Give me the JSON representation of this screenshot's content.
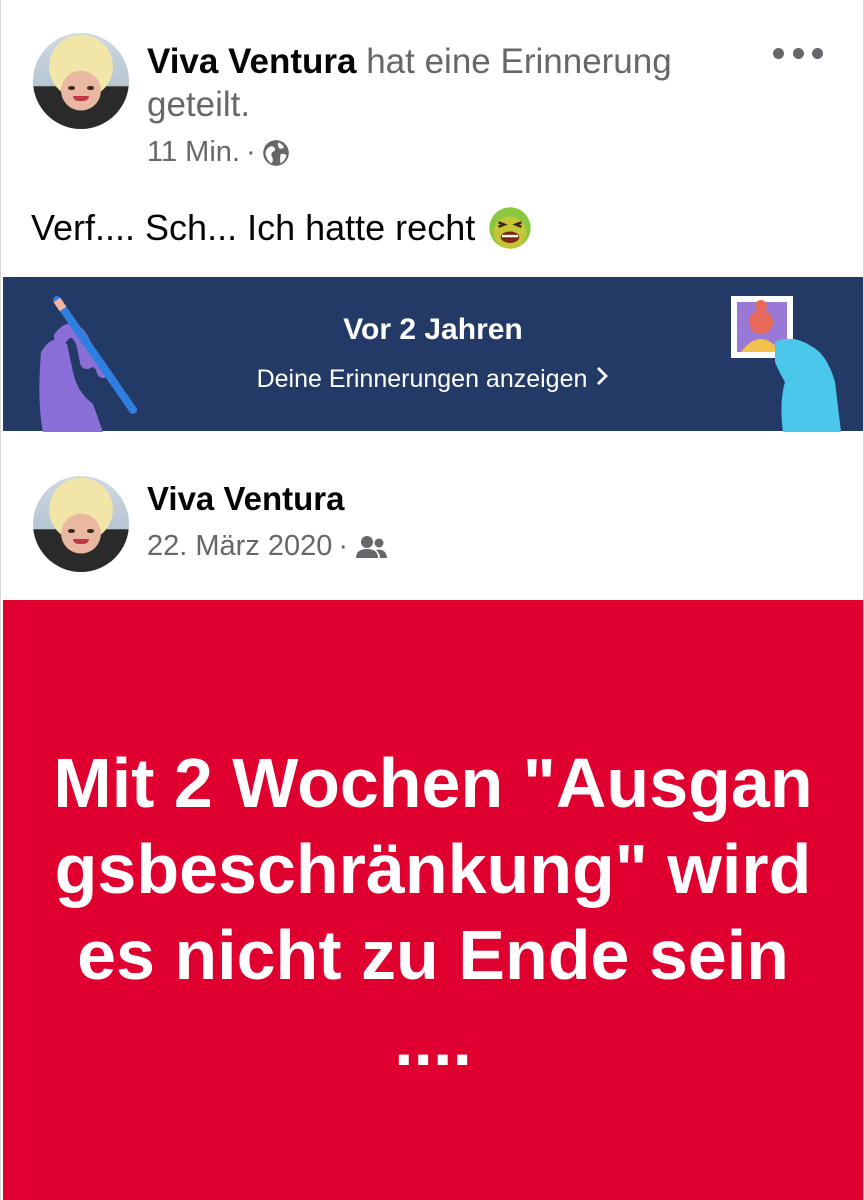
{
  "post": {
    "author": "Viva Ventura",
    "action": " hat eine Erinnerung geteilt.",
    "time": "11 Min.",
    "separator": " · ",
    "privacy_icon": "globe-icon",
    "more_icon": "more-options-icon",
    "text": "Verf.... Sch... Ich hatte recht",
    "emoji": "nauseated-face-icon"
  },
  "memories_banner": {
    "title": "Vor 2 Jahren",
    "link_label": "Deine Erinnerungen anzeigen",
    "colors": {
      "background": "#243a66",
      "left_hand": "#8a6fd8",
      "right_hand": "#4cc7ec"
    }
  },
  "original_post": {
    "author": "Viva Ventura",
    "date": "22. März 2020",
    "separator": " · ",
    "audience_icon": "friends-icon",
    "text": "Mit 2 Wochen \"Ausgangsbeschränkung\" wird es nicht zu Ende sein ....",
    "background_color": "#e0002f"
  }
}
